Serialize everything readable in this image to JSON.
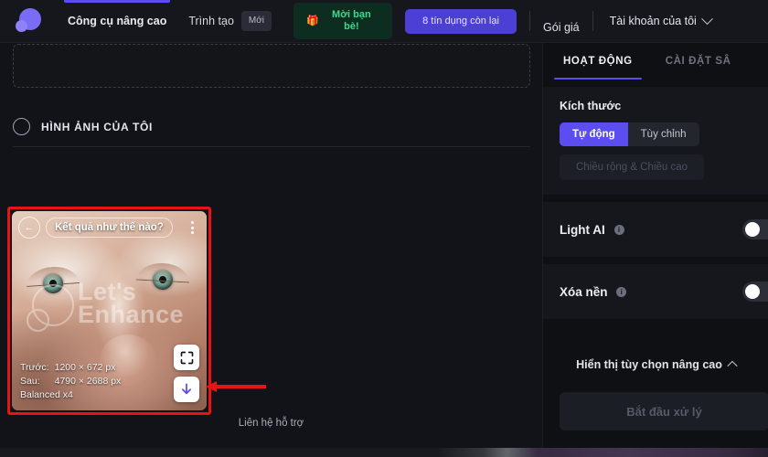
{
  "topnav": {
    "logo_icon": "lets-enhance-logo",
    "items": [
      {
        "label": "Công cụ nâng cao",
        "active": true
      },
      {
        "label": "Trình tạo",
        "active": false,
        "badge": "Mới"
      }
    ],
    "invite": {
      "label": "Mời bạn bè!",
      "icon": "gift-icon",
      "color": "#3fd98b",
      "bg": "#0e2d21"
    },
    "credits": {
      "label": "8 tín dụng còn lại",
      "bg": "#4c3fd6"
    },
    "pricing": "Gói giá",
    "account": "Tài khoản của tôi",
    "account_chevron": "chevron-down-icon"
  },
  "main": {
    "dropzone_label": "",
    "section_title": "HÌNH ẢNH CỦA TÔI",
    "support_link": "Liên hệ hỗ trợ"
  },
  "card": {
    "compare_icon": "compare-arrow-icon",
    "rating_pill": "Kết quả như thế nào?",
    "menu_icon": "kebab-menu-icon",
    "watermark": "Let's\nEnhance",
    "meta": {
      "before_label": "Trước:",
      "before_value": "1200 × 672 px",
      "after_label": "Sau:",
      "after_value": "4790 × 2688 px",
      "mode": "Balanced x4"
    },
    "fullscreen_icon": "fullscreen-icon",
    "download_icon": "download-arrow-icon",
    "highlight_color": "#e81414"
  },
  "panel": {
    "tabs": [
      {
        "label": "HOẠT ĐỘNG",
        "active": true
      },
      {
        "label": "CÀI ĐẶT SÂ",
        "active": false
      }
    ],
    "size": {
      "title": "Kích thước",
      "options": [
        {
          "label": "Tự động",
          "selected": true
        },
        {
          "label": "Tùy chỉnh",
          "selected": false
        }
      ],
      "wh_field": "Chiều rộng & Chiều cao"
    },
    "light_ai": {
      "label": "Light AI",
      "info_icon": "info-icon",
      "enabled": false
    },
    "remove_bg": {
      "label": "Xóa nền",
      "info_icon": "info-icon",
      "enabled": false
    },
    "advanced_toggle": "Hiển thị tùy chọn nâng cao",
    "advanced_chevron": "chevron-up-icon",
    "start_button": "Bắt đầu xử lý"
  }
}
